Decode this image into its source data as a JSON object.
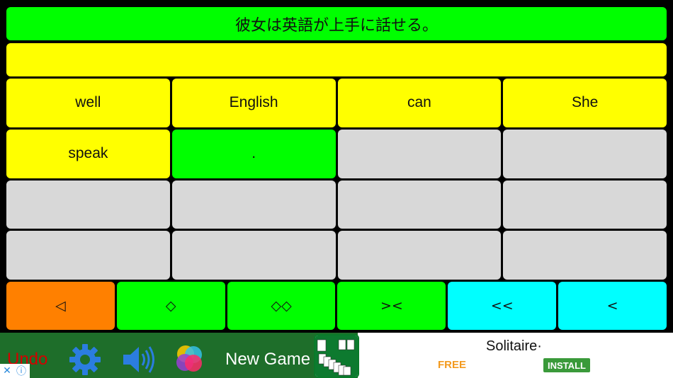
{
  "prompt": {
    "sentence": "彼女は英語が上手に話せる。"
  },
  "answer": {
    "text": ""
  },
  "tiles": [
    {
      "label": "well",
      "color": "yellow"
    },
    {
      "label": "English",
      "color": "yellow"
    },
    {
      "label": "can",
      "color": "yellow"
    },
    {
      "label": "She",
      "color": "yellow"
    },
    {
      "label": "speak",
      "color": "yellow"
    },
    {
      "label": ".",
      "color": "green"
    },
    {
      "label": "",
      "color": "gray"
    },
    {
      "label": "",
      "color": "gray"
    },
    {
      "label": "",
      "color": "gray"
    },
    {
      "label": "",
      "color": "gray"
    },
    {
      "label": "",
      "color": "gray"
    },
    {
      "label": "",
      "color": "gray"
    },
    {
      "label": "",
      "color": "gray"
    },
    {
      "label": "",
      "color": "gray"
    },
    {
      "label": "",
      "color": "gray"
    },
    {
      "label": "",
      "color": "gray"
    }
  ],
  "controls": [
    {
      "label": "◁",
      "color": "orange"
    },
    {
      "label": "◇",
      "color": "green"
    },
    {
      "label": "◇◇",
      "color": "green"
    },
    {
      "label": "><",
      "color": "green"
    },
    {
      "label": "<<",
      "color": "cyan"
    },
    {
      "label": "<",
      "color": "cyan"
    }
  ],
  "toolbar": {
    "undo_label": "Undo",
    "new_game_label": "New Game",
    "icons": [
      "gear-icon",
      "speaker-icon",
      "color-circles-icon"
    ]
  },
  "ad": {
    "title": "Solitaire·",
    "price": "FREE",
    "install_label": "INSTALL",
    "close_glyph": "✕",
    "info_glyph": "ⓘ"
  },
  "colors": {
    "green": "#00ff00",
    "yellow": "#ffff00",
    "gray": "#d8d8d8",
    "orange": "#ff8000",
    "cyan": "#00ffff",
    "toolbar": "#1e6e2a",
    "undo": "#d40000"
  }
}
